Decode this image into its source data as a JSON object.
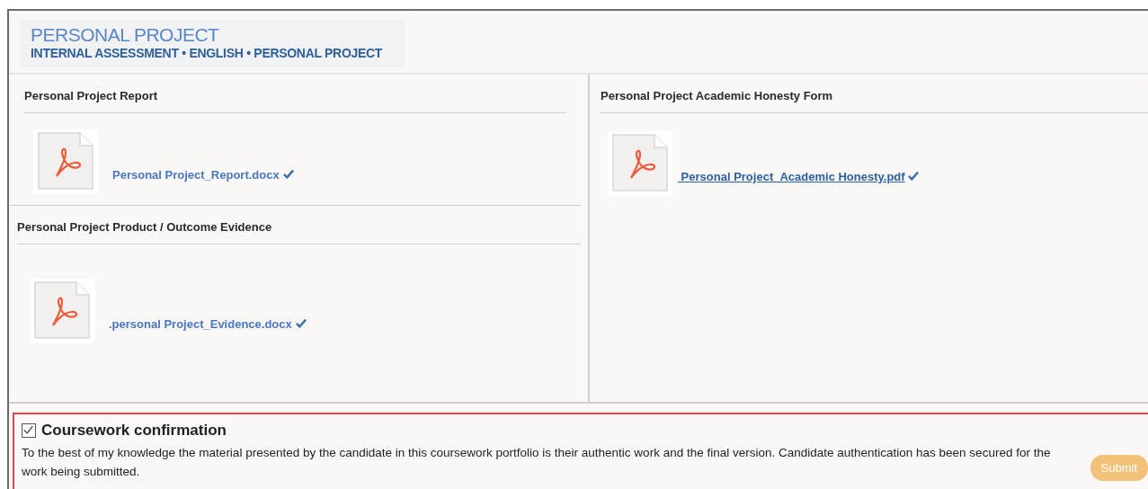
{
  "header": {
    "title": "PERSONAL PROJECT",
    "subtitle": "INTERNAL ASSESSMENT • ENGLISH • PERSONAL PROJECT"
  },
  "columns": [
    {
      "sections": [
        {
          "title": "Personal Project Report",
          "files": [
            {
              "name": "Personal Project_Report.docx",
              "verified": true,
              "focused": false
            }
          ]
        },
        {
          "title": "Personal Project Product / Outcome Evidence",
          "files": [
            {
              "name": ".personal Project_Evidence.docx",
              "verified": true,
              "focused": false
            }
          ]
        }
      ]
    },
    {
      "sections": [
        {
          "title": "Personal Project Academic Honesty Form",
          "files": [
            {
              "name": " Personal Project_Academic Honesty.pdf",
              "verified": true,
              "focused": true
            }
          ]
        }
      ]
    }
  ],
  "confirmation": {
    "checked": true,
    "title": "Coursework confirmation",
    "text": "To the best of my knowledge the material presented by the candidate in this coursework portfolio is their authentic work and the final version. Candidate authentication has been secured for the work being submitted.",
    "submit": {
      "label": "Submit",
      "disabled": true
    }
  }
}
